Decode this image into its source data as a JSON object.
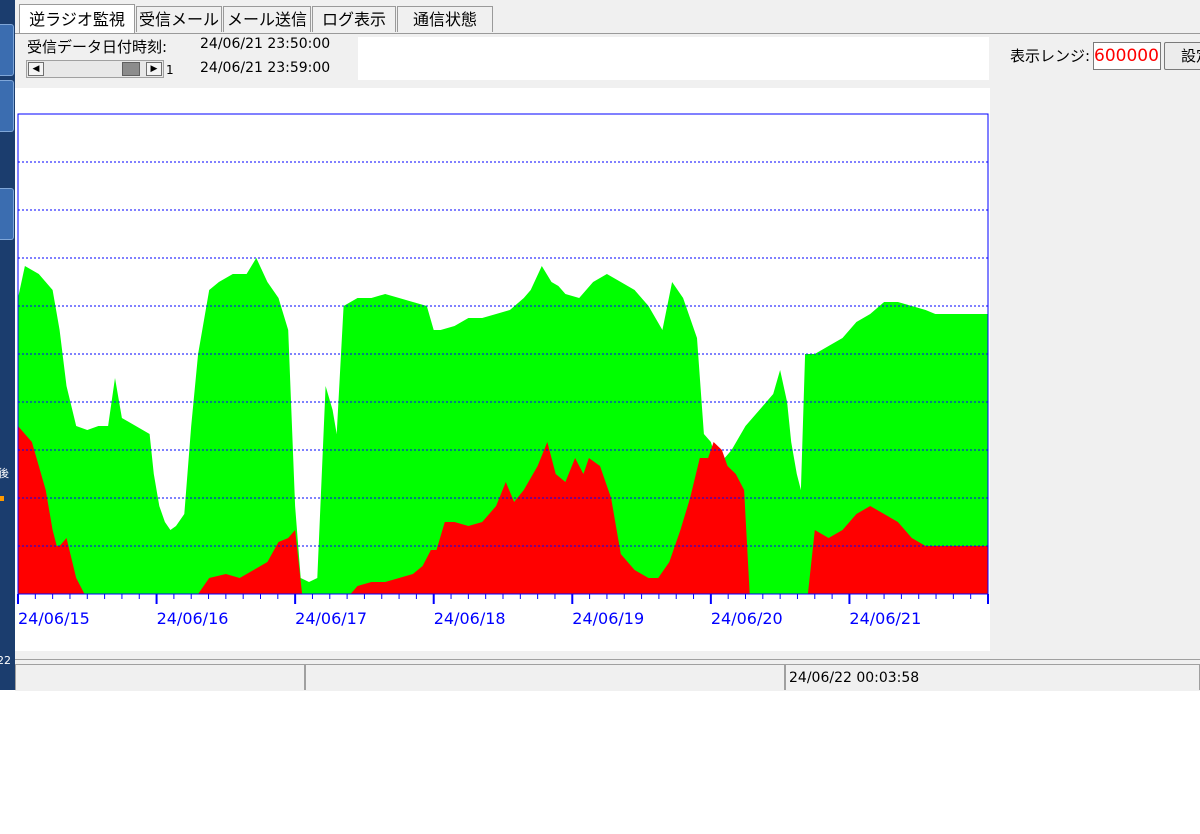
{
  "tabs": [
    {
      "label": "逆ラジオ監視",
      "active": true
    },
    {
      "label": "受信メール",
      "active": false
    },
    {
      "label": "メール送信",
      "active": false
    },
    {
      "label": "ログ表示",
      "active": false
    },
    {
      "label": "通信状態",
      "active": false
    }
  ],
  "header": {
    "received_datetime_label": "受信データ日付時刻:",
    "datetime_start": "24/06/21 23:50:00",
    "datetime_end": "24/06/21 23:59:00",
    "scroll_value": "1",
    "display_range_label": "表示レンジ:",
    "display_range_value": "600000",
    "set_button_label": "設定"
  },
  "left_strip": {
    "texts": [
      "後",
      "22"
    ]
  },
  "status": {
    "timestamp": "24/06/22 00:03:58"
  },
  "colors": {
    "series_green": "#00ff00",
    "series_red": "#ff0000",
    "axis": "#0000ff",
    "grid": "#0000ff"
  },
  "chart_data": {
    "type": "area",
    "x_tick_labels": [
      "24/06/15",
      "24/06/16",
      "24/06/17",
      "24/06/18",
      "24/06/19",
      "24/06/20",
      "24/06/21"
    ],
    "x_range_days": [
      0,
      7
    ],
    "y_range": [
      0,
      600000
    ],
    "grid": "horizontal dashed, 10 divisions",
    "series": [
      {
        "color": "#00ff00",
        "points": [
          [
            0.0,
            370000
          ],
          [
            0.05,
            410000
          ],
          [
            0.15,
            400000
          ],
          [
            0.25,
            380000
          ],
          [
            0.3,
            330000
          ],
          [
            0.35,
            260000
          ],
          [
            0.42,
            210000
          ],
          [
            0.5,
            205000
          ],
          [
            0.58,
            210000
          ],
          [
            0.65,
            210000
          ],
          [
            0.7,
            270000
          ],
          [
            0.75,
            220000
          ],
          [
            0.8,
            215000
          ],
          [
            0.85,
            210000
          ],
          [
            0.9,
            205000
          ],
          [
            0.95,
            200000
          ],
          [
            0.98,
            150000
          ],
          [
            1.02,
            110000
          ],
          [
            1.06,
            90000
          ],
          [
            1.1,
            80000
          ],
          [
            1.14,
            85000
          ],
          [
            1.2,
            100000
          ],
          [
            1.25,
            210000
          ],
          [
            1.3,
            300000
          ],
          [
            1.38,
            380000
          ],
          [
            1.45,
            390000
          ],
          [
            1.55,
            400000
          ],
          [
            1.65,
            400000
          ],
          [
            1.72,
            420000
          ],
          [
            1.8,
            390000
          ],
          [
            1.88,
            370000
          ],
          [
            1.95,
            330000
          ],
          [
            2.0,
            110000
          ],
          [
            2.04,
            20000
          ],
          [
            2.1,
            15000
          ],
          [
            2.16,
            20000
          ],
          [
            2.22,
            260000
          ],
          [
            2.27,
            230000
          ],
          [
            2.3,
            200000
          ],
          [
            2.35,
            360000
          ],
          [
            2.45,
            370000
          ],
          [
            2.55,
            370000
          ],
          [
            2.65,
            375000
          ],
          [
            2.75,
            370000
          ],
          [
            2.85,
            365000
          ],
          [
            2.95,
            360000
          ],
          [
            3.0,
            330000
          ],
          [
            3.05,
            330000
          ],
          [
            3.15,
            335000
          ],
          [
            3.25,
            345000
          ],
          [
            3.35,
            345000
          ],
          [
            3.45,
            350000
          ],
          [
            3.55,
            355000
          ],
          [
            3.65,
            370000
          ],
          [
            3.7,
            380000
          ],
          [
            3.78,
            410000
          ],
          [
            3.85,
            390000
          ],
          [
            3.9,
            385000
          ],
          [
            3.95,
            375000
          ],
          [
            4.05,
            370000
          ],
          [
            4.15,
            390000
          ],
          [
            4.25,
            400000
          ],
          [
            4.35,
            390000
          ],
          [
            4.45,
            380000
          ],
          [
            4.55,
            360000
          ],
          [
            4.65,
            330000
          ],
          [
            4.72,
            390000
          ],
          [
            4.8,
            370000
          ],
          [
            4.9,
            320000
          ],
          [
            4.95,
            200000
          ],
          [
            5.0,
            190000
          ],
          [
            5.05,
            160000
          ],
          [
            5.15,
            180000
          ],
          [
            5.25,
            210000
          ],
          [
            5.35,
            230000
          ],
          [
            5.45,
            250000
          ],
          [
            5.5,
            280000
          ],
          [
            5.55,
            240000
          ],
          [
            5.58,
            190000
          ],
          [
            5.62,
            150000
          ],
          [
            5.65,
            130000
          ],
          [
            5.68,
            300000
          ],
          [
            5.75,
            300000
          ],
          [
            5.85,
            310000
          ],
          [
            5.95,
            320000
          ],
          [
            6.05,
            340000
          ],
          [
            6.15,
            350000
          ],
          [
            6.25,
            365000
          ],
          [
            6.35,
            365000
          ],
          [
            6.45,
            360000
          ],
          [
            6.55,
            355000
          ],
          [
            6.62,
            350000
          ],
          [
            6.69,
            350000
          ],
          [
            7.0,
            350000
          ]
        ]
      },
      {
        "color": "#ff0000",
        "points": [
          [
            0.0,
            210000
          ],
          [
            0.05,
            200000
          ],
          [
            0.1,
            190000
          ],
          [
            0.15,
            160000
          ],
          [
            0.2,
            130000
          ],
          [
            0.25,
            80000
          ],
          [
            0.28,
            60000
          ],
          [
            0.3,
            60000
          ],
          [
            0.35,
            70000
          ],
          [
            0.42,
            20000
          ],
          [
            0.48,
            0
          ],
          [
            1.3,
            0
          ],
          [
            1.38,
            20000
          ],
          [
            1.5,
            25000
          ],
          [
            1.6,
            20000
          ],
          [
            1.7,
            30000
          ],
          [
            1.8,
            40000
          ],
          [
            1.88,
            65000
          ],
          [
            1.95,
            70000
          ],
          [
            2.0,
            80000
          ],
          [
            2.05,
            0
          ],
          [
            2.4,
            0
          ],
          [
            2.45,
            10000
          ],
          [
            2.55,
            15000
          ],
          [
            2.65,
            15000
          ],
          [
            2.75,
            20000
          ],
          [
            2.85,
            25000
          ],
          [
            2.92,
            35000
          ],
          [
            2.98,
            55000
          ],
          [
            3.02,
            55000
          ],
          [
            3.08,
            90000
          ],
          [
            3.15,
            90000
          ],
          [
            3.25,
            85000
          ],
          [
            3.35,
            90000
          ],
          [
            3.45,
            110000
          ],
          [
            3.52,
            140000
          ],
          [
            3.58,
            115000
          ],
          [
            3.65,
            130000
          ],
          [
            3.75,
            160000
          ],
          [
            3.82,
            190000
          ],
          [
            3.88,
            150000
          ],
          [
            3.95,
            140000
          ],
          [
            4.02,
            170000
          ],
          [
            4.08,
            150000
          ],
          [
            4.12,
            170000
          ],
          [
            4.2,
            160000
          ],
          [
            4.28,
            120000
          ],
          [
            4.35,
            50000
          ],
          [
            4.45,
            30000
          ],
          [
            4.55,
            20000
          ],
          [
            4.62,
            20000
          ],
          [
            4.7,
            40000
          ],
          [
            4.78,
            80000
          ],
          [
            4.85,
            120000
          ],
          [
            4.92,
            170000
          ],
          [
            4.98,
            170000
          ],
          [
            5.02,
            190000
          ],
          [
            5.08,
            180000
          ],
          [
            5.12,
            160000
          ],
          [
            5.18,
            150000
          ],
          [
            5.24,
            130000
          ],
          [
            5.28,
            0
          ],
          [
            5.7,
            0
          ],
          [
            5.75,
            80000
          ],
          [
            5.85,
            70000
          ],
          [
            5.95,
            80000
          ],
          [
            6.05,
            100000
          ],
          [
            6.15,
            110000
          ],
          [
            6.25,
            100000
          ],
          [
            6.35,
            90000
          ],
          [
            6.45,
            70000
          ],
          [
            6.55,
            60000
          ],
          [
            6.62,
            60000
          ],
          [
            6.69,
            60000
          ],
          [
            7.0,
            60000
          ]
        ]
      }
    ]
  }
}
